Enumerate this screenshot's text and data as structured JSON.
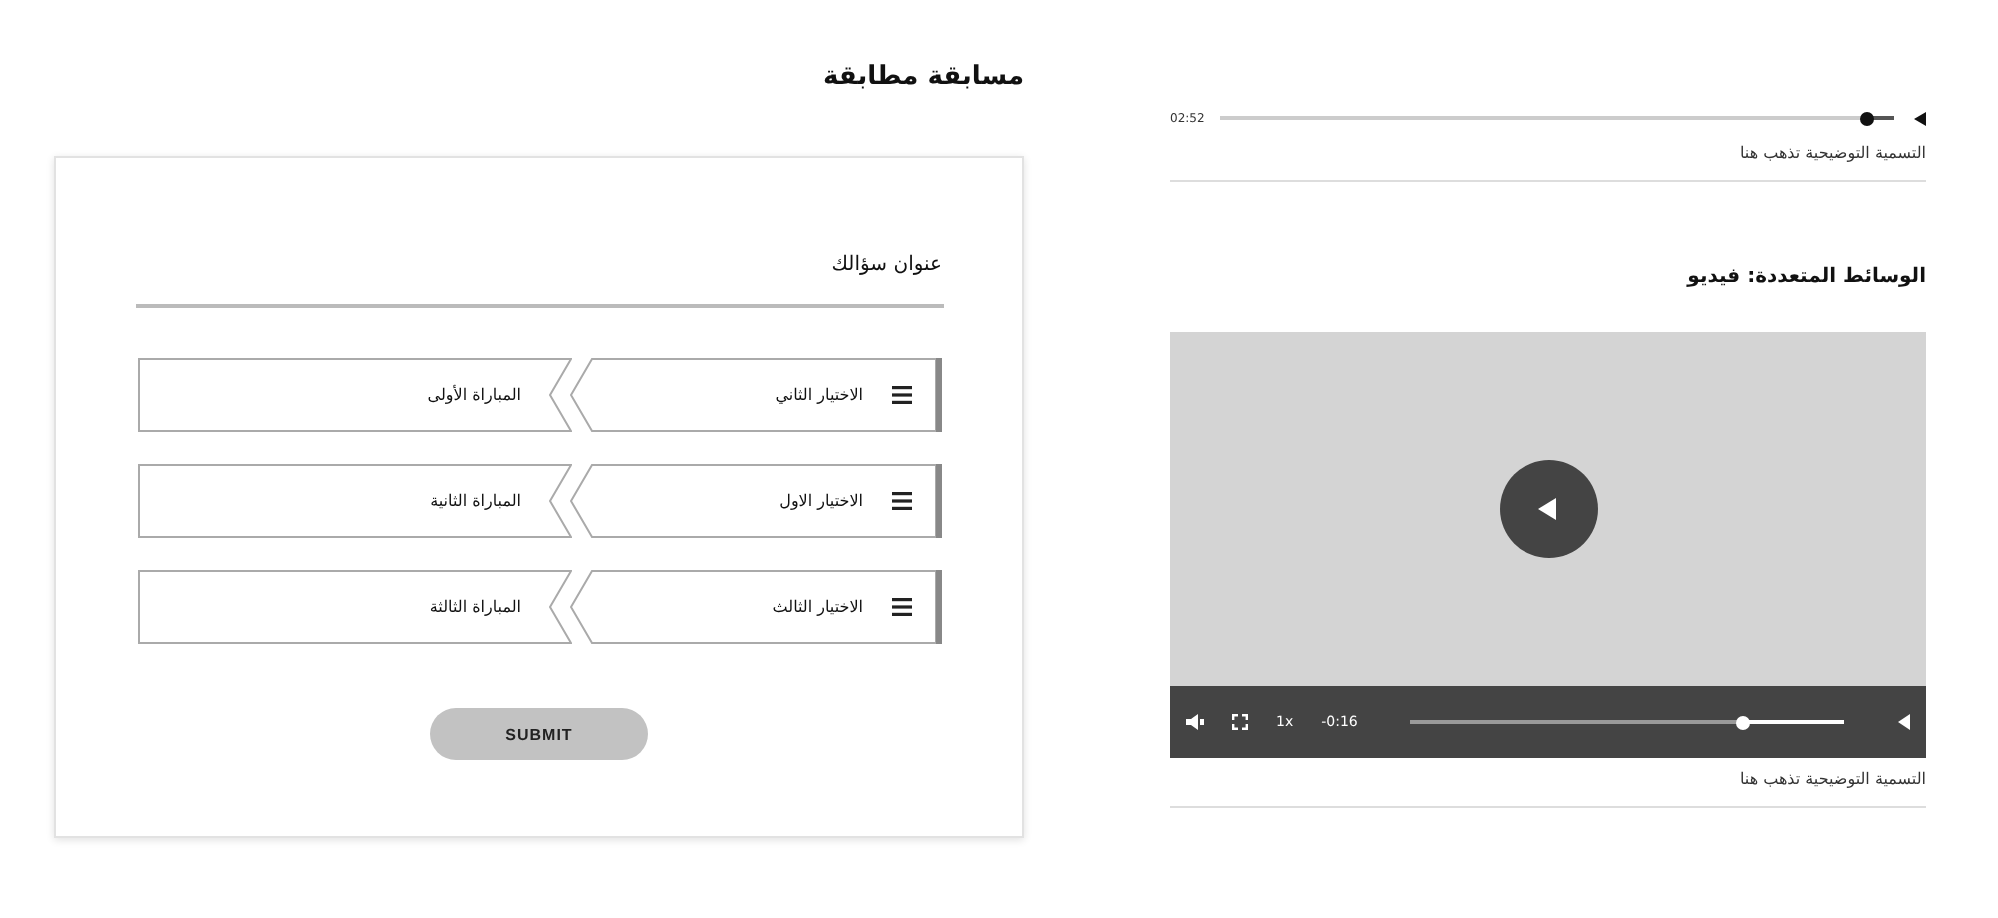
{
  "quiz": {
    "title": "مسابقة مطابقة",
    "question": "عنوان سؤالك",
    "pairs": [
      {
        "choice": "الاختيار الثاني",
        "match": "المباراة الأولى"
      },
      {
        "choice": "الاختيار الاول",
        "match": "المباراة الثانية"
      },
      {
        "choice": "الاختيار الثالث",
        "match": "المباراة الثالثة"
      }
    ],
    "submit": "SUBMIT"
  },
  "audio": {
    "time": "02:52",
    "level": 0.96,
    "caption": "التسمية التوضيحية تذهب هنا"
  },
  "video": {
    "heading": "الوسائط المتعددة: فيديو",
    "speed": "1x",
    "time": "-0:16",
    "caption": "التسمية التوضيحية تذهب هنا"
  }
}
